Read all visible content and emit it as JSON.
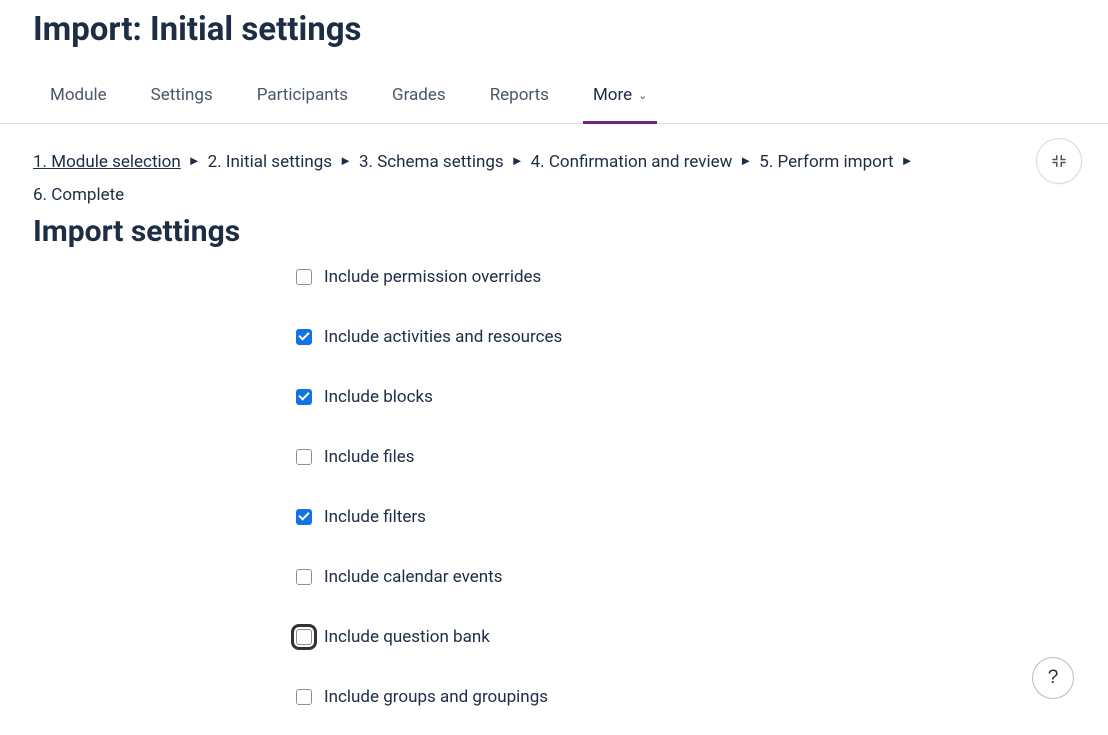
{
  "header": {
    "title": "Import: Initial settings"
  },
  "nav": {
    "tabs": [
      {
        "label": "Module",
        "active": false
      },
      {
        "label": "Settings",
        "active": false
      },
      {
        "label": "Participants",
        "active": false
      },
      {
        "label": "Grades",
        "active": false
      },
      {
        "label": "Reports",
        "active": false
      },
      {
        "label": "More",
        "active": true,
        "hasDropdown": true
      }
    ]
  },
  "steps": {
    "items": [
      {
        "label": "1. Module selection",
        "link": true
      },
      {
        "label": "2. Initial settings",
        "link": false
      },
      {
        "label": "3. Schema settings",
        "link": false
      },
      {
        "label": "4. Confirmation and review",
        "link": false
      },
      {
        "label": "5. Perform import",
        "link": false
      },
      {
        "label": "6. Complete",
        "link": false
      }
    ],
    "arrow": "►"
  },
  "section": {
    "title": "Import settings"
  },
  "checkboxes": [
    {
      "label": "Include permission overrides",
      "checked": false,
      "highlight": false
    },
    {
      "label": "Include activities and resources",
      "checked": true,
      "highlight": false
    },
    {
      "label": "Include blocks",
      "checked": true,
      "highlight": false
    },
    {
      "label": "Include files",
      "checked": false,
      "highlight": false
    },
    {
      "label": "Include filters",
      "checked": true,
      "highlight": false
    },
    {
      "label": "Include calendar events",
      "checked": false,
      "highlight": false
    },
    {
      "label": "Include question bank",
      "checked": false,
      "highlight": true
    },
    {
      "label": "Include groups and groupings",
      "checked": false,
      "highlight": false
    }
  ],
  "help": {
    "label": "?"
  }
}
